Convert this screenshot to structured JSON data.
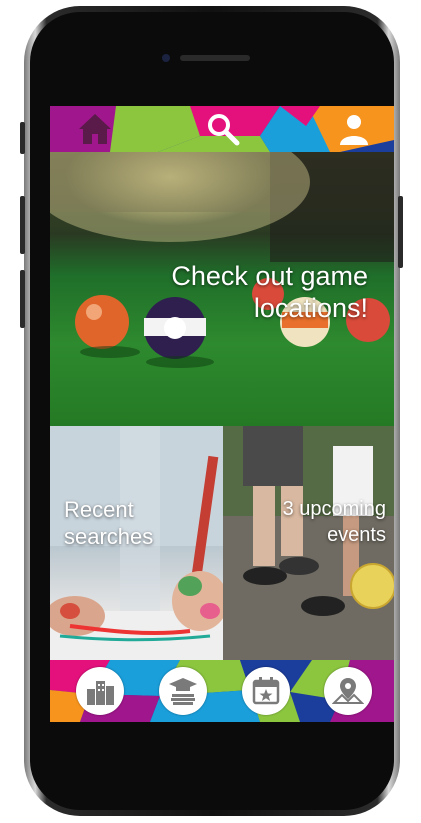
{
  "device": "phone-mockup",
  "top_nav": {
    "icons": [
      "home-icon",
      "search-icon",
      "user-icon"
    ],
    "colors": [
      "#a0168c",
      "#8cc63f",
      "#e4117d",
      "#1a9fdb",
      "#f7941d",
      "#1b3d9c"
    ]
  },
  "hero": {
    "text": "Check out game locations!"
  },
  "tiles": {
    "recent_searches": "Recent searches",
    "upcoming_events": "3 upcoming events"
  },
  "bottom_nav": {
    "icons": [
      "buildings-icon",
      "graduation-books-icon",
      "calendar-star-icon",
      "map-pin-icon"
    ]
  }
}
